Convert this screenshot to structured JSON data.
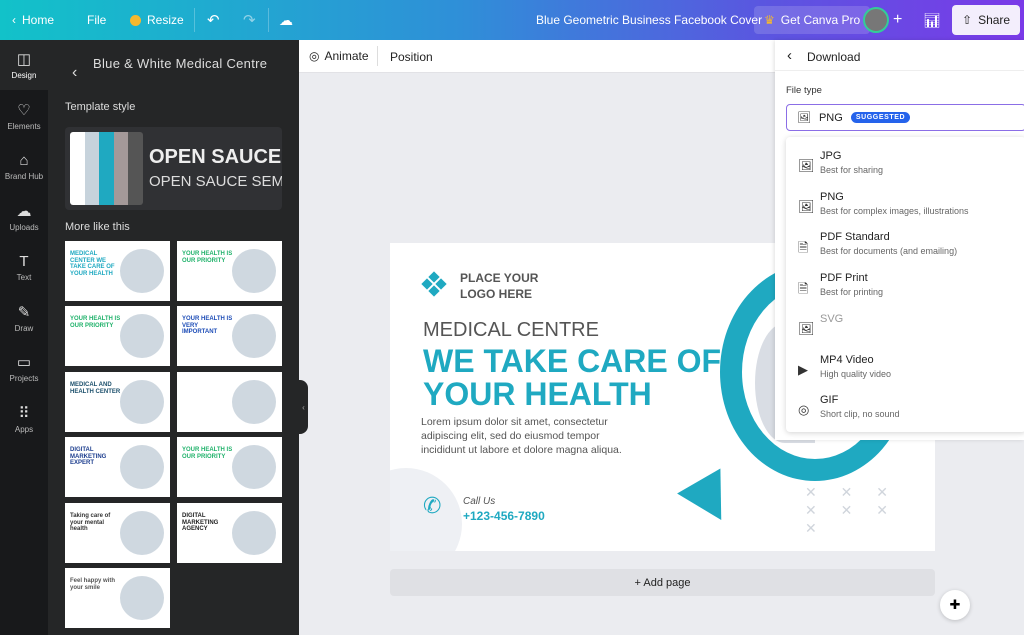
{
  "topbar": {
    "home": "Home",
    "file": "File",
    "resize": "Resize",
    "title": "Blue Geometric Business Facebook Cover",
    "pro": "Get Canva Pro",
    "share": "Share",
    "gradient_start": "#12c2c9",
    "gradient_end": "#7a3ae8"
  },
  "rail": [
    {
      "label": "Design",
      "icon": "layout-icon"
    },
    {
      "label": "Elements",
      "icon": "shapes-icon"
    },
    {
      "label": "Brand Hub",
      "icon": "brand-icon"
    },
    {
      "label": "Uploads",
      "icon": "cloud-upload-icon"
    },
    {
      "label": "Text",
      "icon": "text-icon"
    },
    {
      "label": "Draw",
      "icon": "pen-icon"
    },
    {
      "label": "Projects",
      "icon": "folder-icon"
    },
    {
      "label": "Apps",
      "icon": "grid-icon"
    }
  ],
  "panel": {
    "title": "Blue & White Medical Centre",
    "template_style": "Template style",
    "font_heading": "OPEN SAUCE",
    "font_sub": "OPEN SAUCE SEMI",
    "palette": [
      "#ffffff",
      "#c7d3dc",
      "#1fa9c1",
      "#a49999",
      "#555555"
    ],
    "more": "More like this",
    "thumbs": [
      {
        "text": "MEDICAL CENTER WE TAKE CARE OF YOUR HEALTH",
        "color": "#1fa9c1"
      },
      {
        "text": "YOUR HEALTH IS OUR PRIORITY",
        "color": "#20b26b"
      },
      {
        "text": "YOUR HEALTH IS OUR PRIORITY",
        "color": "#20b26b"
      },
      {
        "text": "YOUR HEALTH IS VERY IMPORTANT",
        "color": "#1e4db7"
      },
      {
        "text": "MEDICAL AND HEALTH CENTER",
        "color": "#1b4f6b"
      },
      {
        "text": "",
        "color": "#5a6f8c"
      },
      {
        "text": "DIGITAL MARKETING EXPERT",
        "color": "#1e3f8f"
      },
      {
        "text": "YOUR HEALTH IS OUR PRIORITY",
        "color": "#20b26b"
      },
      {
        "text": "Taking care of your mental health",
        "color": "#333333"
      },
      {
        "text": "DIGITAL MARKETING AGENCY",
        "color": "#222222"
      },
      {
        "text": "Feel happy with your smile",
        "color": "#555555"
      }
    ]
  },
  "toolbar": {
    "animate": "Animate",
    "position": "Position"
  },
  "design": {
    "logo": "PLACE YOUR LOGO HERE",
    "subtitle": "MEDICAL CENTRE",
    "headline1": "WE TAKE CARE OF",
    "headline2": "YOUR HEALTH",
    "body": "Lorem ipsum dolor sit amet, consectetur adipiscing elit, sed do eiusmod tempor incididunt ut labore et dolore magna aliqua.",
    "call": "Call Us",
    "phone": "+123-456-7890",
    "accent": "#1fa9c1"
  },
  "add_page": "+ Add page",
  "download": {
    "title": "Download",
    "file_type_label": "File type",
    "selected": "PNG",
    "badge": "SUGGESTED",
    "options": [
      {
        "name": "JPG",
        "desc": "Best for sharing",
        "icon": "image-icon"
      },
      {
        "name": "PNG",
        "desc": "Best for complex images, illustrations",
        "icon": "image-icon"
      },
      {
        "name": "PDF Standard",
        "desc": "Best for documents (and emailing)",
        "icon": "document-icon"
      },
      {
        "name": "PDF Print",
        "desc": "Best for printing",
        "icon": "document-icon"
      },
      {
        "name": "SVG",
        "desc": "",
        "icon": "image-icon"
      },
      {
        "name": "MP4 Video",
        "desc": "High quality video",
        "icon": "video-icon"
      },
      {
        "name": "GIF",
        "desc": "Short clip, no sound",
        "icon": "gif-icon"
      }
    ]
  }
}
